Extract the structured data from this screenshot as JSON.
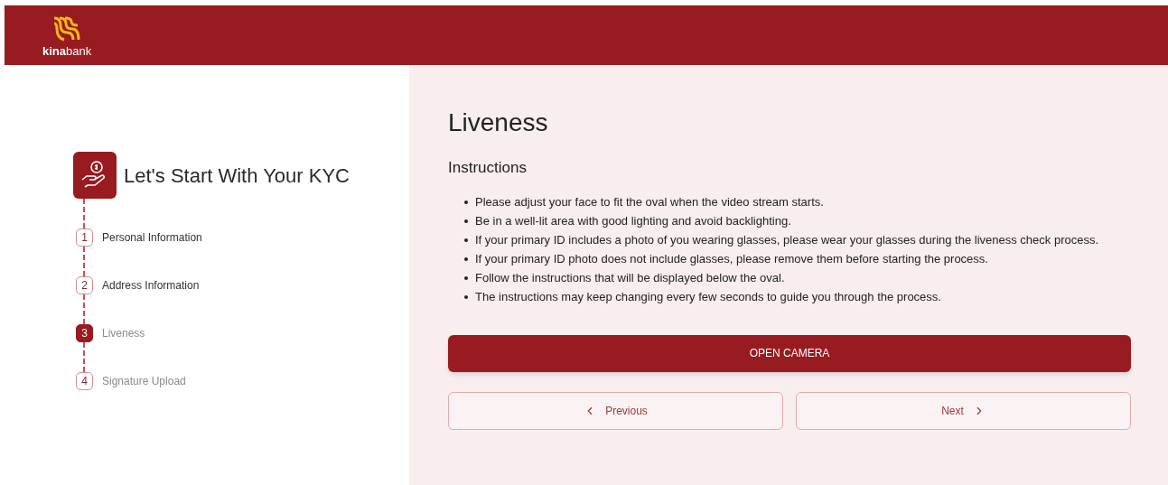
{
  "header": {
    "logo_text": "**kina**bank"
  },
  "sidebar": {
    "title": "Let's Start With Your KYC",
    "steps": [
      {
        "number": "1",
        "label": "Personal Information",
        "selected": false,
        "completed": true
      },
      {
        "number": "2",
        "label": "Address Information",
        "selected": false,
        "completed": true
      },
      {
        "number": "3",
        "label": "Liveness",
        "selected": true,
        "completed": false
      },
      {
        "number": "4",
        "label": "Signature Upload",
        "selected": false,
        "completed": false
      }
    ]
  },
  "main": {
    "title": "Liveness",
    "subtitle": "Instructions",
    "instructions": [
      "Please adjust your face to fit the oval when the video stream starts.",
      "Be in a well-lit area with good lighting and avoid backlighting.",
      "If your primary ID includes a photo of you wearing glasses, please wear your glasses during the liveness check process.",
      "If your primary ID photo does not include glasses, please remove them before starting the process.",
      "Follow the instructions that will be displayed below the oval.",
      "The instructions may keep changing every few seconds to guide you through the process."
    ],
    "primary_button": "OPEN CAMERA",
    "previous_button": "Previous",
    "next_button": "Next"
  }
}
